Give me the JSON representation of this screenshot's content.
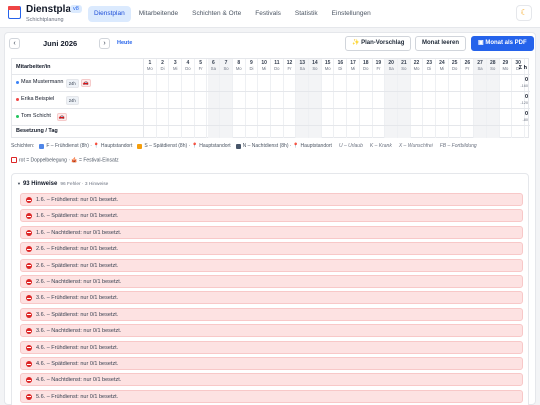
{
  "header": {
    "title": "Dienstplan",
    "version": "v8",
    "subtitle": "Schichtplanung",
    "nav": [
      "Dienstplan",
      "Mitarbeitende",
      "Schichten & Orte",
      "Festivals",
      "Statistik",
      "Einstellungen"
    ],
    "active_nav": "Dienstplan",
    "theme_icon": "moon-icon"
  },
  "toolbar": {
    "prev": "‹",
    "next": "›",
    "month": "Juni 2026",
    "today": "Heute",
    "proposal": "✨ Plan-Vorschlag",
    "clear": "Monat leeren",
    "pdf": "▣ Monat als PDF"
  },
  "grid": {
    "employee_header": "Mitarbeiter/in",
    "sum_header": "Σ h",
    "days": [
      {
        "d": "1",
        "wd": "Mo"
      },
      {
        "d": "2",
        "wd": "Di"
      },
      {
        "d": "3",
        "wd": "Mi"
      },
      {
        "d": "4",
        "wd": "Do"
      },
      {
        "d": "5",
        "wd": "Fr"
      },
      {
        "d": "6",
        "wd": "Sa"
      },
      {
        "d": "7",
        "wd": "So"
      },
      {
        "d": "8",
        "wd": "Mo"
      },
      {
        "d": "9",
        "wd": "Di"
      },
      {
        "d": "10",
        "wd": "Mi"
      },
      {
        "d": "11",
        "wd": "Do"
      },
      {
        "d": "12",
        "wd": "Fr"
      },
      {
        "d": "13",
        "wd": "Sa"
      },
      {
        "d": "14",
        "wd": "So"
      },
      {
        "d": "15",
        "wd": "Mo"
      },
      {
        "d": "16",
        "wd": "Di"
      },
      {
        "d": "17",
        "wd": "Mi"
      },
      {
        "d": "18",
        "wd": "Do"
      },
      {
        "d": "19",
        "wd": "Fr"
      },
      {
        "d": "20",
        "wd": "Sa"
      },
      {
        "d": "21",
        "wd": "So"
      },
      {
        "d": "22",
        "wd": "Mo"
      },
      {
        "d": "23",
        "wd": "Di"
      },
      {
        "d": "24",
        "wd": "Mi"
      },
      {
        "d": "25",
        "wd": "Do"
      },
      {
        "d": "26",
        "wd": "Fr"
      },
      {
        "d": "27",
        "wd": "Sa"
      },
      {
        "d": "28",
        "wd": "So"
      },
      {
        "d": "29",
        "wd": "Mo"
      },
      {
        "d": "30",
        "wd": "Di"
      }
    ],
    "employees": [
      {
        "name": "Max Mustermann",
        "hours": "24h",
        "icon": "🚗",
        "sum": "0",
        "sub": "-160",
        "color": "#3b82f6"
      },
      {
        "name": "Erika Beispiel",
        "hours": "24h",
        "icon": "",
        "sum": "0",
        "sub": "-120",
        "color": "#ef4444"
      },
      {
        "name": "Tom Schicht",
        "hours": "",
        "icon": "🚗",
        "sum": "0",
        "sub": "-80",
        "color": "#22c55e"
      }
    ],
    "footer_label": "Besetzung / Tag"
  },
  "legend": {
    "label": "Schichten:",
    "items": [
      {
        "color": "#4f86e8",
        "text": "F – Frühdienst (8h) · 📍 Hauptstandort"
      },
      {
        "color": "#f59e0b",
        "text": "S – Spätdienst (8h) · 📍 Hauptstandort"
      },
      {
        "color": "#475569",
        "text": "N – Nachtdienst (8h) · 📍 Hauptstandort"
      }
    ],
    "absences": [
      "U – Urlaub",
      "K – Krank",
      "X – Wunschfrei",
      "FB – Fortbildung"
    ],
    "line2": "rot = Doppelbelegung · 🎪 = Festival-Einsatz"
  },
  "hints": {
    "toggle": "▼",
    "title": "93 Hinweise",
    "subtitle": "96 Fehler · 3 Hinweise",
    "items": [
      "1.6. – Frühdienst: nur 0/1 besetzt.",
      "1.6. – Spätdienst: nur 0/1 besetzt.",
      "1.6. – Nachtdienst: nur 0/1 besetzt.",
      "2.6. – Frühdienst: nur 0/1 besetzt.",
      "2.6. – Spätdienst: nur 0/1 besetzt.",
      "2.6. – Nachtdienst: nur 0/1 besetzt.",
      "3.6. – Frühdienst: nur 0/1 besetzt.",
      "3.6. – Spätdienst: nur 0/1 besetzt.",
      "3.6. – Nachtdienst: nur 0/1 besetzt.",
      "4.6. – Frühdienst: nur 0/1 besetzt.",
      "4.6. – Spätdienst: nur 0/1 besetzt.",
      "4.6. – Nachtdienst: nur 0/1 besetzt.",
      "5.6. – Frühdienst: nur 0/1 besetzt."
    ]
  }
}
